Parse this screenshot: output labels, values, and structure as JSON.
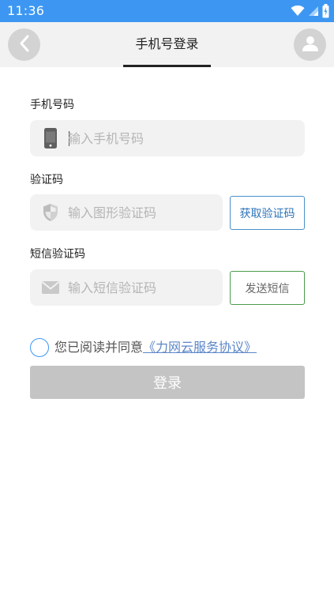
{
  "statusbar": {
    "time": "11:36",
    "icons": [
      "wifi-icon",
      "signal-icon",
      "battery-icon"
    ]
  },
  "header": {
    "title": "手机号登录",
    "back_icon": "chevron-left-icon",
    "avatar_icon": "user-icon"
  },
  "form": {
    "phone": {
      "label": "手机号码",
      "placeholder": "输入手机号码",
      "value": "",
      "icon": "phone-icon"
    },
    "captcha": {
      "label": "验证码",
      "placeholder": "输入图形验证码",
      "value": "",
      "icon": "shield-icon",
      "button_label": "获取验证码"
    },
    "sms": {
      "label": "短信验证码",
      "placeholder": "输入短信验证码",
      "value": "",
      "icon": "mail-icon",
      "button_label": "发送短信"
    }
  },
  "agreement": {
    "checked": false,
    "text": "您已阅读并同意",
    "link_text": "《力网云服务协议》"
  },
  "login_button": {
    "label": "登录"
  },
  "colors": {
    "status_bar": "#3d97f2",
    "header_bg": "#f2f2f2",
    "field_bg": "#f2f2f2",
    "login_disabled": "#c4c4c4",
    "link": "#5b86c8",
    "captcha_button_border": "#4a90c9",
    "sms_button_border": "#4b9b4b"
  }
}
